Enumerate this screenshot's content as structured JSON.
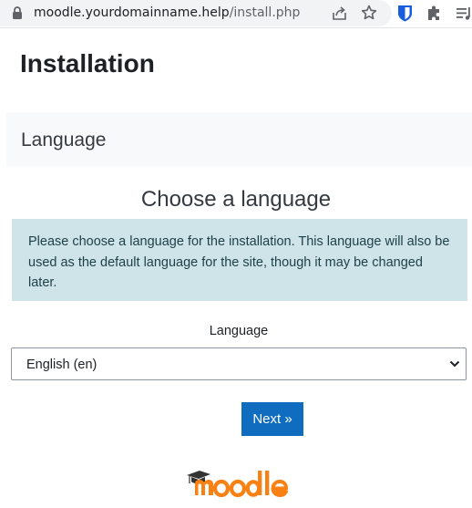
{
  "browser": {
    "url_host": "moodle.yourdomainname.help",
    "url_path": "/install.php",
    "icons": [
      "lock-icon",
      "share-icon",
      "star-icon",
      "bitwarden-icon",
      "puzzle-icon",
      "queue-icon"
    ]
  },
  "page": {
    "title": "Installation",
    "section_label": "Language",
    "heading": "Choose a language",
    "info": "Please choose a language for the installation. This language will also be used as the default language for the site, though it may be changed later.",
    "language_label": "Language",
    "language_selected": "English (en)",
    "next_label": "Next »",
    "logo_text": "moodle"
  },
  "colors": {
    "primary": "#0f6cbf",
    "info_bg": "#cfe4e8",
    "logo_orange": "#f98012",
    "logo_grey": "#333333"
  }
}
